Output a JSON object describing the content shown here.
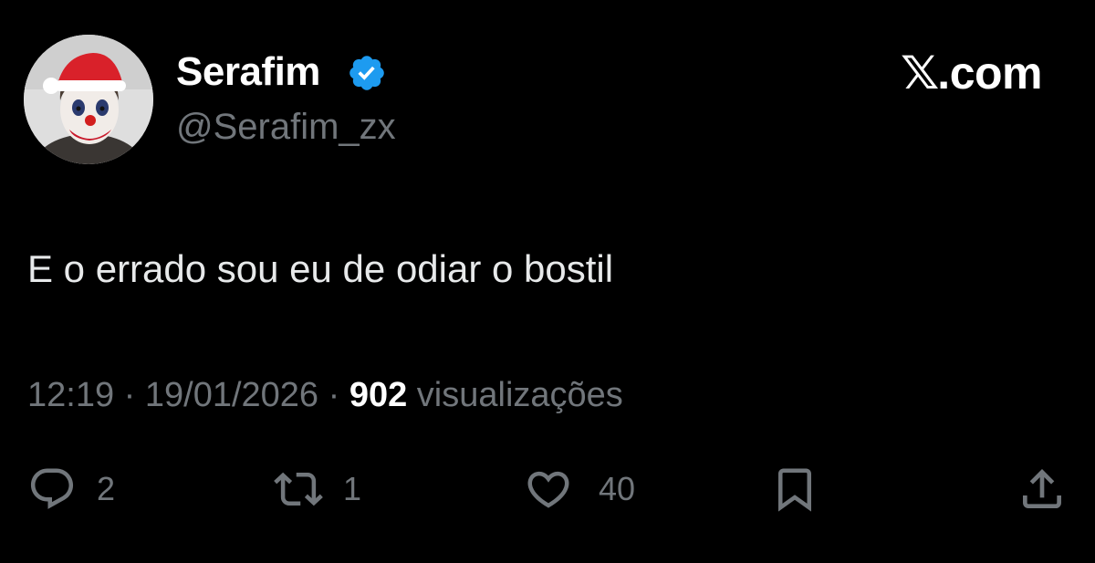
{
  "author": {
    "display_name": "Serafim",
    "handle": "@Serafim_zx",
    "verified": true,
    "verified_color": "#1d9bf0"
  },
  "brand": {
    "logo_mark": "𝕏",
    "logo_suffix": ".com"
  },
  "tweet": {
    "text": "E o errado sou eu de odiar o bostil",
    "time": "12:19",
    "separator": " · ",
    "date": "19/01/2026",
    "views_count": "902",
    "views_label": " visualizações"
  },
  "actions": {
    "replies": {
      "icon": "reply-icon",
      "count": "2"
    },
    "retweets": {
      "icon": "retweet-icon",
      "count": "1"
    },
    "likes": {
      "icon": "heart-icon",
      "count": "40"
    },
    "bookmark": {
      "icon": "bookmark-icon"
    },
    "share": {
      "icon": "share-icon"
    }
  },
  "colors": {
    "background": "#000000",
    "text": "#e7e9ea",
    "secondary": "#71767b"
  }
}
